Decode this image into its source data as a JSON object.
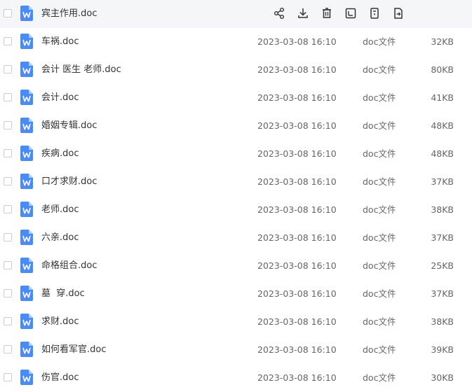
{
  "files": [
    {
      "name": "宾主作用.doc",
      "date": "",
      "type": "",
      "size": "",
      "hovered": true
    },
    {
      "name": "车祸.doc",
      "date": "2023-03-08 16:10",
      "type": "doc文件",
      "size": "32KB"
    },
    {
      "name": "会计 医生 老师.doc",
      "date": "2023-03-08 16:10",
      "type": "doc文件",
      "size": "80KB"
    },
    {
      "name": "会计.doc",
      "date": "2023-03-08 16:10",
      "type": "doc文件",
      "size": "41KB"
    },
    {
      "name": "婚姻专辑.doc",
      "date": "2023-03-08 16:10",
      "type": "doc文件",
      "size": "48KB"
    },
    {
      "name": "疾病.doc",
      "date": "2023-03-08 16:10",
      "type": "doc文件",
      "size": "48KB"
    },
    {
      "name": "口才求财.doc",
      "date": "2023-03-08 16:10",
      "type": "doc文件",
      "size": "37KB"
    },
    {
      "name": "老师.doc",
      "date": "2023-03-08 16:10",
      "type": "doc文件",
      "size": "38KB"
    },
    {
      "name": "六亲.doc",
      "date": "2023-03-08 16:10",
      "type": "doc文件",
      "size": "37KB"
    },
    {
      "name": "命格组合.doc",
      "date": "2023-03-08 16:10",
      "type": "doc文件",
      "size": "25KB"
    },
    {
      "name": "墓  穿.doc",
      "date": "2023-03-08 16:10",
      "type": "doc文件",
      "size": "37KB"
    },
    {
      "name": "求财.doc",
      "date": "2023-03-08 16:10",
      "type": "doc文件",
      "size": "38KB"
    },
    {
      "name": "如何看军官.doc",
      "date": "2023-03-08 16:10",
      "type": "doc文件",
      "size": "39KB"
    },
    {
      "name": "伤官.doc",
      "date": "2023-03-08 16:10",
      "type": "doc文件",
      "size": "30KB"
    }
  ],
  "hover_actions": [
    "share-icon",
    "download-icon",
    "delete-icon",
    "rename-icon",
    "copy-icon",
    "move-icon"
  ],
  "colors": {
    "doc_icon": "#4a8cf7",
    "hover_bg": "#f5f6fa",
    "action_icon": "#333333"
  }
}
